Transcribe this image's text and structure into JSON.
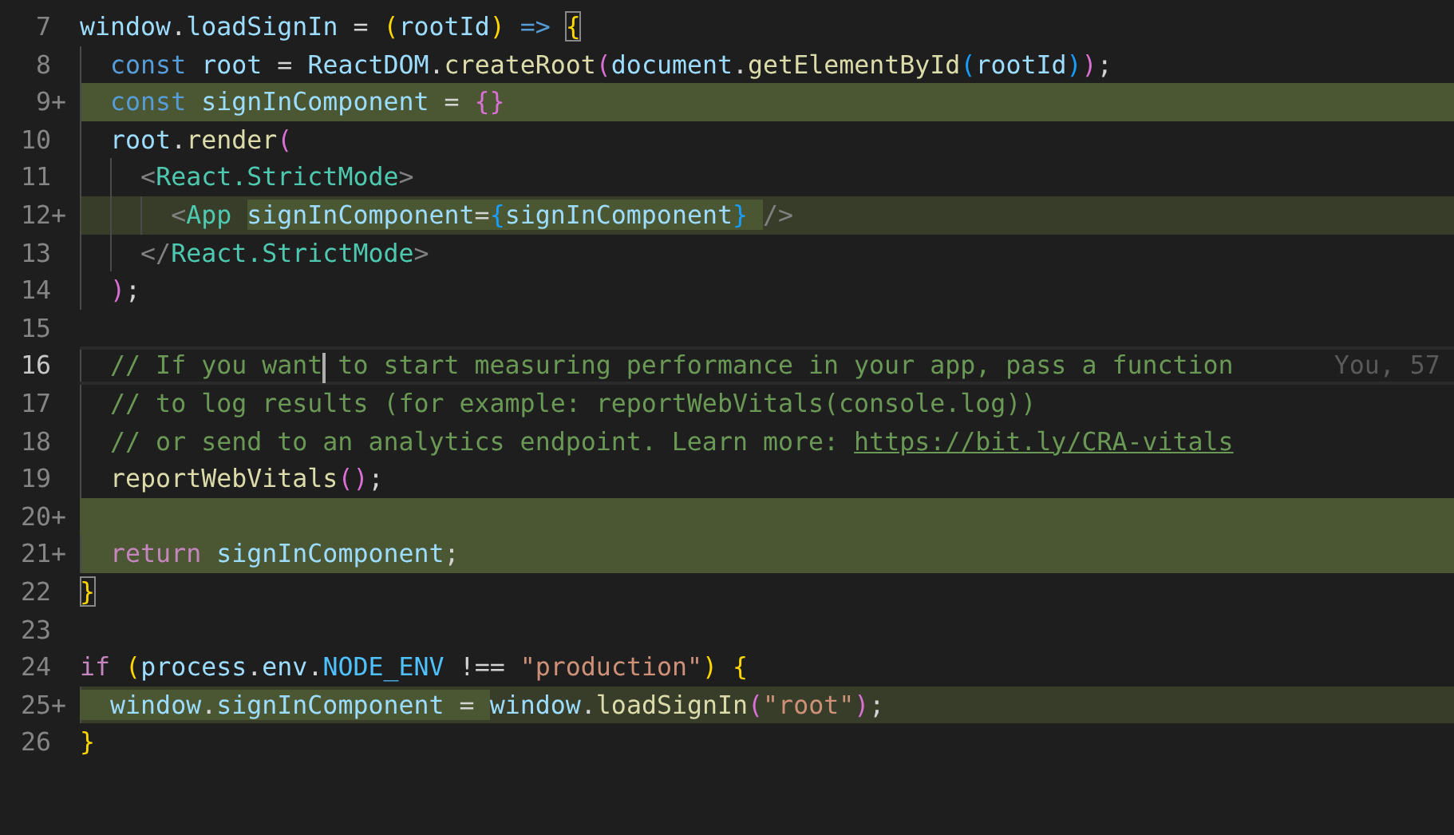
{
  "editor": {
    "lines": [
      {
        "number": "7",
        "kind": "plain",
        "current": false,
        "tokens": [
          {
            "text": "window",
            "kind": "variable"
          },
          {
            "text": ".",
            "kind": "plain"
          },
          {
            "text": "loadSignIn",
            "kind": "variable"
          },
          {
            "text": " = ",
            "kind": "plain"
          },
          {
            "text": "(",
            "kind": "bracket-gold"
          },
          {
            "text": "rootId",
            "kind": "variable"
          },
          {
            "text": ")",
            "kind": "bracket-gold"
          },
          {
            "text": " => ",
            "kind": "keyword"
          },
          {
            "text": "{",
            "kind": "matched-bracket"
          }
        ]
      },
      {
        "number": "8",
        "kind": "plain",
        "current": false,
        "tokens": [
          {
            "text": "  const",
            "kind": "keyword"
          },
          {
            "text": " root",
            "kind": "variable"
          },
          {
            "text": " = ",
            "kind": "plain"
          },
          {
            "text": "ReactDOM",
            "kind": "variable"
          },
          {
            "text": ".",
            "kind": "plain"
          },
          {
            "text": "createRoot",
            "kind": "function"
          },
          {
            "text": "(",
            "kind": "bracket-purple"
          },
          {
            "text": "document",
            "kind": "variable"
          },
          {
            "text": ".",
            "kind": "plain"
          },
          {
            "text": "getElementById",
            "kind": "function"
          },
          {
            "text": "(",
            "kind": "bracket-blue"
          },
          {
            "text": "rootId",
            "kind": "variable"
          },
          {
            "text": ")",
            "kind": "bracket-blue"
          },
          {
            "text": ")",
            "kind": "bracket-purple"
          },
          {
            "text": ";",
            "kind": "plain"
          }
        ]
      },
      {
        "number": "9",
        "marker": "+",
        "kind": "added",
        "current": false,
        "tokens": [
          {
            "text": "  const",
            "kind": "keyword"
          },
          {
            "text": " signInComponent",
            "kind": "variable"
          },
          {
            "text": " = ",
            "kind": "plain"
          },
          {
            "text": "{}",
            "kind": "bracket-purple"
          }
        ]
      },
      {
        "number": "10",
        "kind": "plain",
        "current": false,
        "tokens": [
          {
            "text": "  root",
            "kind": "variable"
          },
          {
            "text": ".",
            "kind": "plain"
          },
          {
            "text": "render",
            "kind": "function"
          },
          {
            "text": "(",
            "kind": "bracket-purple"
          }
        ]
      },
      {
        "number": "11",
        "kind": "plain",
        "current": false,
        "tokens": [
          {
            "text": "    <",
            "kind": "tag-punct"
          },
          {
            "text": "React.StrictMode",
            "kind": "tag"
          },
          {
            "text": ">",
            "kind": "tag-punct"
          }
        ]
      },
      {
        "number": "12",
        "marker": "+",
        "kind": "modified",
        "current": false,
        "tokens": [
          {
            "text": "      <",
            "kind": "tag-punct",
            "highlighted": false
          },
          {
            "text": "App ",
            "kind": "tag",
            "highlighted": false
          },
          {
            "text": "signInComponent",
            "kind": "variable",
            "highlighted": true
          },
          {
            "text": "=",
            "kind": "plain",
            "highlighted": true
          },
          {
            "text": "{",
            "kind": "bracket-blue",
            "highlighted": true
          },
          {
            "text": "signInComponent",
            "kind": "variable",
            "highlighted": true
          },
          {
            "text": "} ",
            "kind": "bracket-blue",
            "highlighted": true
          },
          {
            "text": "/>",
            "kind": "tag-punct",
            "highlighted": false
          }
        ]
      },
      {
        "number": "13",
        "kind": "plain",
        "current": false,
        "tokens": [
          {
            "text": "    </",
            "kind": "tag-punct"
          },
          {
            "text": "React.StrictMode",
            "kind": "tag"
          },
          {
            "text": ">",
            "kind": "tag-punct"
          }
        ]
      },
      {
        "number": "14",
        "kind": "plain",
        "current": false,
        "tokens": [
          {
            "text": "  )",
            "kind": "bracket-purple"
          },
          {
            "text": ";",
            "kind": "plain"
          }
        ]
      },
      {
        "number": "15",
        "kind": "plain",
        "current": false
      },
      {
        "number": "16",
        "kind": "plain",
        "current": true,
        "blame": "You, 57",
        "tokens": [
          {
            "text": "  // If you want",
            "kind": "comment"
          },
          {
            "kind": "cursor"
          },
          {
            "text": " to start measuring performance in your app, pass a function",
            "kind": "comment"
          }
        ]
      },
      {
        "number": "17",
        "kind": "plain",
        "current": false,
        "tokens": [
          {
            "text": "  // to log results (for example: reportWebVitals(console.log))",
            "kind": "comment"
          }
        ]
      },
      {
        "number": "18",
        "kind": "plain",
        "current": false,
        "tokens": [
          {
            "text": "  // or send to an analytics endpoint. Learn more: ",
            "kind": "comment"
          },
          {
            "text": "https://bit.ly/CRA-vitals",
            "kind": "link"
          }
        ]
      },
      {
        "number": "19",
        "kind": "plain",
        "current": false,
        "tokens": [
          {
            "text": "  reportWebVitals",
            "kind": "function"
          },
          {
            "text": "()",
            "kind": "bracket-purple"
          },
          {
            "text": ";",
            "kind": "plain"
          }
        ]
      },
      {
        "number": "20",
        "marker": "+",
        "kind": "added",
        "current": false
      },
      {
        "number": "21",
        "marker": "+",
        "kind": "added",
        "current": false,
        "tokens": [
          {
            "text": "  return",
            "kind": "control"
          },
          {
            "text": " signInComponent",
            "kind": "variable"
          },
          {
            "text": ";",
            "kind": "plain"
          }
        ]
      },
      {
        "number": "22",
        "kind": "plain",
        "current": false,
        "tokens": [
          {
            "text": "}",
            "kind": "matched-bracket"
          }
        ]
      },
      {
        "number": "23",
        "kind": "plain",
        "current": false
      },
      {
        "number": "24",
        "kind": "plain",
        "current": false,
        "tokens": [
          {
            "text": "if ",
            "kind": "control"
          },
          {
            "text": "(",
            "kind": "bracket-gold"
          },
          {
            "text": "process",
            "kind": "variable"
          },
          {
            "text": ".",
            "kind": "plain"
          },
          {
            "text": "env",
            "kind": "variable"
          },
          {
            "text": ".",
            "kind": "plain"
          },
          {
            "text": "NODE_ENV",
            "kind": "constant"
          },
          {
            "text": " !== ",
            "kind": "plain"
          },
          {
            "text": "\"production\"",
            "kind": "string"
          },
          {
            "text": ") ",
            "kind": "bracket-gold"
          },
          {
            "text": "{",
            "kind": "bracket-gold"
          }
        ]
      },
      {
        "number": "25",
        "marker": "+",
        "kind": "modified",
        "current": false,
        "tokens": [
          {
            "text": "  window",
            "kind": "variable",
            "highlighted": true
          },
          {
            "text": ".",
            "kind": "plain",
            "highlighted": true
          },
          {
            "text": "signInComponent",
            "kind": "variable",
            "highlighted": true
          },
          {
            "text": " = ",
            "kind": "plain",
            "highlighted": true
          },
          {
            "text": "window",
            "kind": "variable",
            "highlighted": false
          },
          {
            "text": ".",
            "kind": "plain",
            "highlighted": false
          },
          {
            "text": "loadSignIn",
            "kind": "function",
            "highlighted": false
          },
          {
            "text": "(",
            "kind": "bracket-purple",
            "highlighted": false
          },
          {
            "text": "\"root\"",
            "kind": "string",
            "highlighted": false
          },
          {
            "text": ")",
            "kind": "bracket-purple",
            "highlighted": false
          },
          {
            "text": ";",
            "kind": "plain",
            "highlighted": false
          }
        ]
      },
      {
        "number": "26",
        "kind": "plain",
        "current": false,
        "tokens": [
          {
            "text": "}",
            "kind": "bracket-gold"
          }
        ]
      }
    ]
  }
}
